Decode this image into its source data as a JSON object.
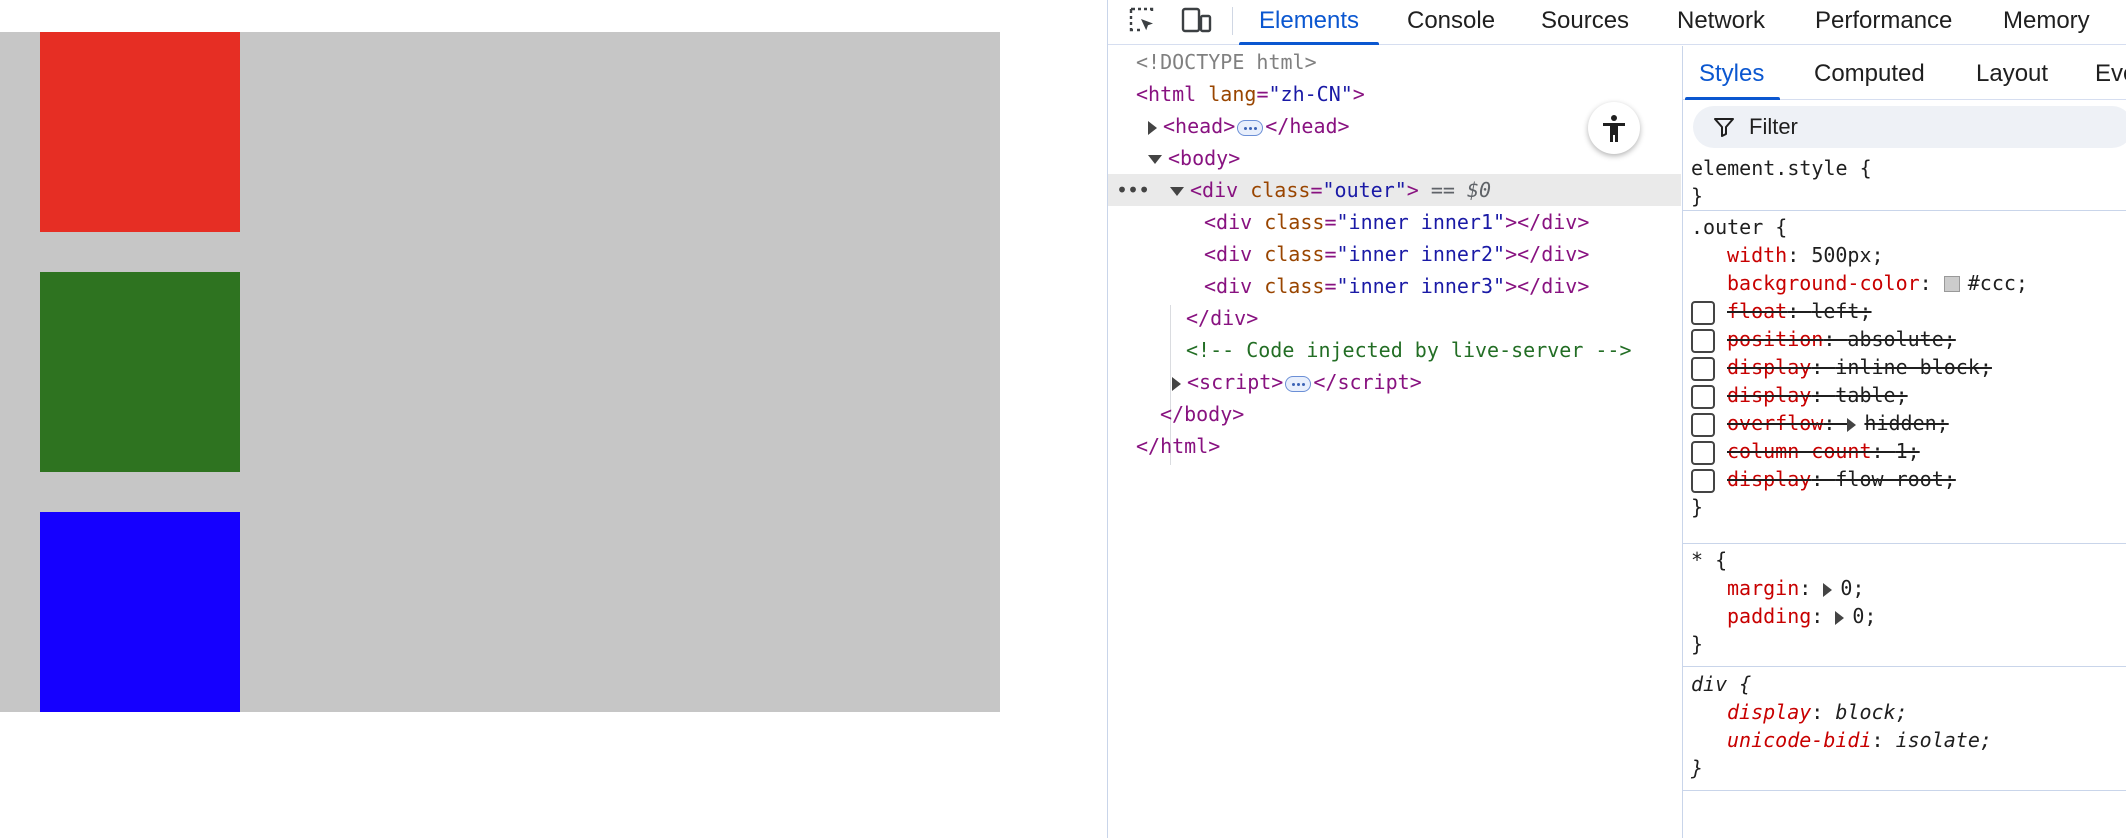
{
  "preview": {
    "colors": {
      "outer_bg": "#c6c6c6",
      "inner1": "#e62e24",
      "inner2": "#2e7320",
      "inner3": "#1500ff"
    }
  },
  "devtools": {
    "toolbar": {
      "tabs": [
        "Elements",
        "Console",
        "Sources",
        "Network",
        "Performance",
        "Memory"
      ],
      "active_tab": "Elements"
    },
    "dom_tree": {
      "doctype": "<!DOCTYPE html>",
      "html_open_tag": "html",
      "html_lang_attr": "lang",
      "html_lang_value": "\"zh-CN\"",
      "head_tag": "head",
      "body_tag": "body",
      "outer_div": {
        "tag": "div",
        "attr": "class",
        "value": "\"outer\"",
        "marker": "== $0"
      },
      "children": [
        {
          "tag": "div",
          "attr": "class",
          "value": "\"inner inner1\""
        },
        {
          "tag": "div",
          "attr": "class",
          "value": "\"inner inner2\""
        },
        {
          "tag": "div",
          "attr": "class",
          "value": "\"inner inner3\""
        }
      ],
      "close_div": "</div>",
      "comment": "<!-- Code injected by live-server -->",
      "script_tag": "script",
      "close_body": "</body>",
      "close_html": "</html>",
      "gutter_dots": "•••"
    },
    "styles_pane": {
      "tabs": [
        "Styles",
        "Computed",
        "Layout",
        "Eve"
      ],
      "active_tab": "Styles",
      "filter_placeholder": "Filter",
      "rules": {
        "element_style": {
          "selector": "element.style {",
          "close": "}"
        },
        "outer": {
          "selector": ".outer {",
          "width_name": "width",
          "width_value": "500px;",
          "bg_name": "background-color",
          "bg_value": "#ccc;",
          "disabled": [
            {
              "name": "float",
              "value": "left;"
            },
            {
              "name": "position",
              "value": "absolute;"
            },
            {
              "name": "display",
              "value": "inline-block;"
            },
            {
              "name": "display",
              "value": "table;"
            },
            {
              "name": "overflow",
              "value": "hidden;"
            },
            {
              "name": "column-count",
              "value": "1;"
            },
            {
              "name": "display",
              "value": "flow-root;"
            }
          ],
          "close": "}"
        },
        "universal": {
          "selector": "* {",
          "margin_name": "margin",
          "margin_value": "0;",
          "padding_name": "padding",
          "padding_value": "0;",
          "close": "}"
        },
        "div_ua": {
          "selector": "div {",
          "display_name": "display",
          "display_value": "block;",
          "unicode_name": "unicode-bidi",
          "unicode_value": "isolate;",
          "close": "}"
        }
      }
    }
  }
}
